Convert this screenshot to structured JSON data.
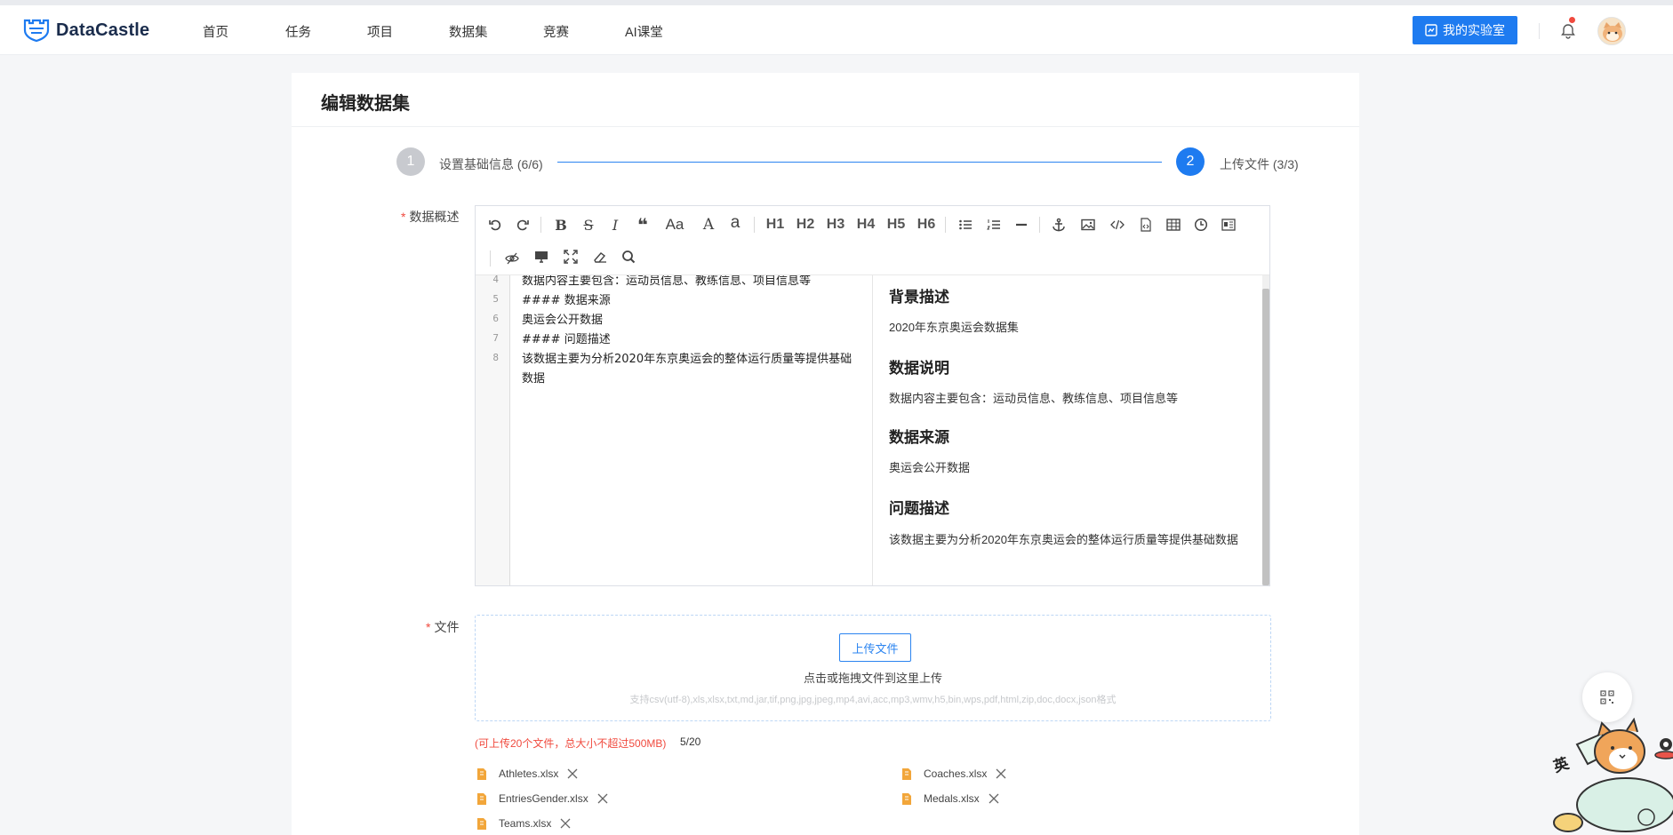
{
  "brand": {
    "name": "DataCastle"
  },
  "nav": {
    "items": [
      "首页",
      "任务",
      "项目",
      "数据集",
      "竞赛",
      "AI课堂"
    ]
  },
  "header": {
    "lab_button": "我的实验室"
  },
  "page": {
    "title": "编辑数据集"
  },
  "steps": [
    {
      "number": "1",
      "label": "设置基础信息 (6/6)"
    },
    {
      "number": "2",
      "label": "上传文件 (3/3)"
    }
  ],
  "overview": {
    "label": "数据概述",
    "toolbar": {
      "headings": [
        "H1",
        "H2",
        "H3",
        "H4",
        "H5",
        "H6"
      ],
      "text_aa": "Aa",
      "text_a_big": "A",
      "text_a_small": "a"
    },
    "code_lines": [
      {
        "n": "4",
        "text": "数据内容主要包含：运动员信息、教练信息、项目信息等"
      },
      {
        "n": "5",
        "text": "#### 数据来源"
      },
      {
        "n": "6",
        "text": "奥运会公开数据"
      },
      {
        "n": "7",
        "text": "#### 问题描述"
      },
      {
        "n": "8",
        "text": "该数据主要为分析2020年东京奥运会的整体运行质量等提供基础"
      },
      {
        "n": "",
        "text": "数据"
      }
    ],
    "preview": {
      "h_background": "背景描述",
      "p_background": "2020年东京奥运会数据集",
      "h_description": "数据说明",
      "p_description": "数据内容主要包含：运动员信息、教练信息、项目信息等",
      "h_source": "数据来源",
      "p_source": "奥运会公开数据",
      "h_problem": "问题描述",
      "p_problem": "该数据主要为分析2020年东京奥运会的整体运行质量等提供基础数据"
    }
  },
  "files": {
    "label": "文件",
    "upload_button": "上传文件",
    "drop_text": "点击或拖拽文件到这里上传",
    "formats_hint": "支持csv(utf-8),xls,xlsx,txt,md,jar,tif,png,jpg,jpeg,mp4,avi,acc,mp3,wmv,h5,bin,wps,pdf,html,zip,doc,docx,json格式",
    "limit_note": "(可上传20个文件，总大小不超过500MB)",
    "count": "5/20",
    "list": [
      "Athletes.xlsx",
      "Coaches.xlsx",
      "EntriesGender.xlsx",
      "Medals.xlsx",
      "Teams.xlsx"
    ]
  },
  "mascot": {
    "badge_char": "英"
  },
  "colors": {
    "primary": "#1e7bf0",
    "danger": "#f04a3e",
    "step_inactive": "#c8cacf"
  }
}
